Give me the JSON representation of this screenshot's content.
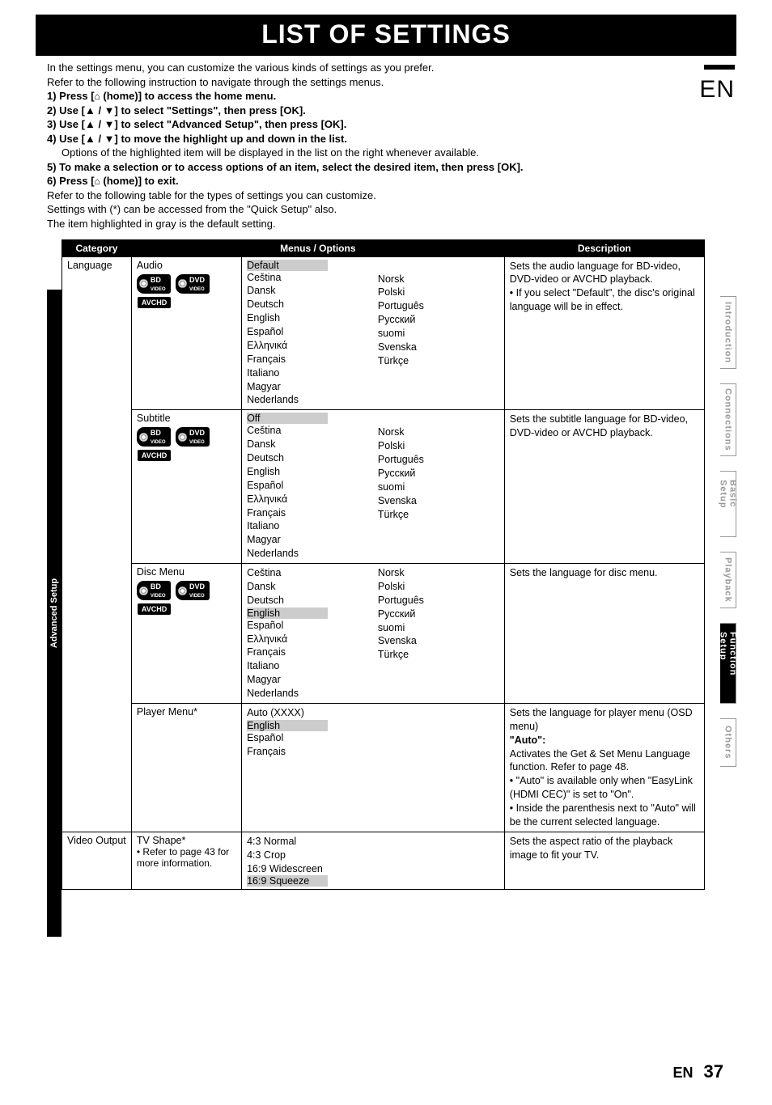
{
  "page": {
    "title": "LIST OF SETTINGS",
    "lang_badge": "EN",
    "footer_lang": "EN",
    "footer_page": "37"
  },
  "intro": {
    "line1": "In the settings menu, you can customize the various kinds of settings as you prefer.",
    "line2": "Refer to the following instruction to navigate through the settings menus.",
    "step1a": "1)  Press [",
    "step1b": " (home)] to access the home menu.",
    "step2": "2)  Use [▲ / ▼] to select \"Settings\", then press [OK].",
    "step3": "3)  Use [▲ / ▼] to select \"Advanced Setup\", then press [OK].",
    "step4": "4)  Use [▲ / ▼] to move the highlight up and down in the list.",
    "step4_sub": "Options of the highlighted item will be displayed in the list on the right whenever available.",
    "step5": "5)  To make a selection or to access options of an item, select the desired item, then press [OK].",
    "step6a": "6)  Press [",
    "step6b": " (home)] to exit.",
    "post1": "Refer to the following table for the types of settings you can customize.",
    "post2": "Settings with (*) can be accessed from the \"Quick Setup\" also.",
    "post3": "The item highlighted in gray is the default setting."
  },
  "side_left": "Advanced Setup",
  "headers": {
    "category": "Category",
    "menus": "Menus / Options",
    "description": "Description"
  },
  "right_tabs": [
    "Introduction",
    "Connections",
    "Basic Setup",
    "Playback",
    "Function Setup",
    "Others"
  ],
  "right_active": "Function Setup",
  "badges": {
    "bd": "BD",
    "bd_sub": "VIDEO",
    "dvd": "DVD",
    "dvd_sub": "VIDEO",
    "avchd": "AVCHD"
  },
  "rows": {
    "language": {
      "category": "Language",
      "audio": {
        "label": "Audio",
        "default": "Default",
        "col1": [
          "Ceština",
          "Dansk",
          "Deutsch",
          "English",
          "Español",
          "Ελληνικά",
          "Français",
          "Italiano",
          "Magyar",
          "Nederlands"
        ],
        "col2": [
          "Norsk",
          "Polski",
          "Português",
          "Русский",
          "suomi",
          "Svenska",
          "Türkçe"
        ],
        "desc": [
          "Sets the audio language for BD-video, DVD-video or AVCHD playback.",
          "• If you select \"Default\", the disc's original language will be in effect."
        ]
      },
      "subtitle": {
        "label": "Subtitle",
        "default": "Off",
        "col1": [
          "Ceština",
          "Dansk",
          "Deutsch",
          "English",
          "Español",
          "Ελληνικά",
          "Français",
          "Italiano",
          "Magyar",
          "Nederlands"
        ],
        "col2": [
          "Norsk",
          "Polski",
          "Português",
          "Русский",
          "suomi",
          "Svenska",
          "Türkçe"
        ],
        "desc": [
          "Sets the subtitle language for BD-video, DVD-video or AVCHD playback."
        ]
      },
      "discmenu": {
        "label": "Disc Menu",
        "default": "English",
        "col1_pre": [
          "Ceština",
          "Dansk",
          "Deutsch"
        ],
        "col1_post": [
          "Español",
          "Ελληνικά",
          "Français",
          "Italiano",
          "Magyar",
          "Nederlands"
        ],
        "col2": [
          "Norsk",
          "Polski",
          "Português",
          "Русский",
          "suomi",
          "Svenska",
          "Türkçe"
        ],
        "desc": [
          "Sets the language for disc menu."
        ]
      },
      "playermenu": {
        "label": "Player Menu*",
        "opts_pre": [
          "Auto (XXXX)"
        ],
        "default": "English",
        "opts_post": [
          "Español",
          "Français"
        ],
        "desc": [
          "Sets the language for player menu (OSD menu)",
          "\"Auto\":",
          "Activates the Get & Set Menu Language function. Refer to page 48.",
          "• \"Auto\" is available only when \"EasyLink (HDMI CEC)\" is set to \"On\".",
          "• Inside the parenthesis next to \"Auto\" will be the current selected language."
        ]
      }
    },
    "video": {
      "category": "Video Output",
      "tvshape": {
        "label": "TV Shape*",
        "sub": "• Refer to page 43 for more information.",
        "opts_pre": [
          "4:3 Normal",
          "4:3 Crop",
          "16:9 Widescreen"
        ],
        "default": "16:9 Squeeze",
        "desc": [
          "Sets the aspect ratio of the playback image to fit your TV."
        ]
      }
    }
  }
}
